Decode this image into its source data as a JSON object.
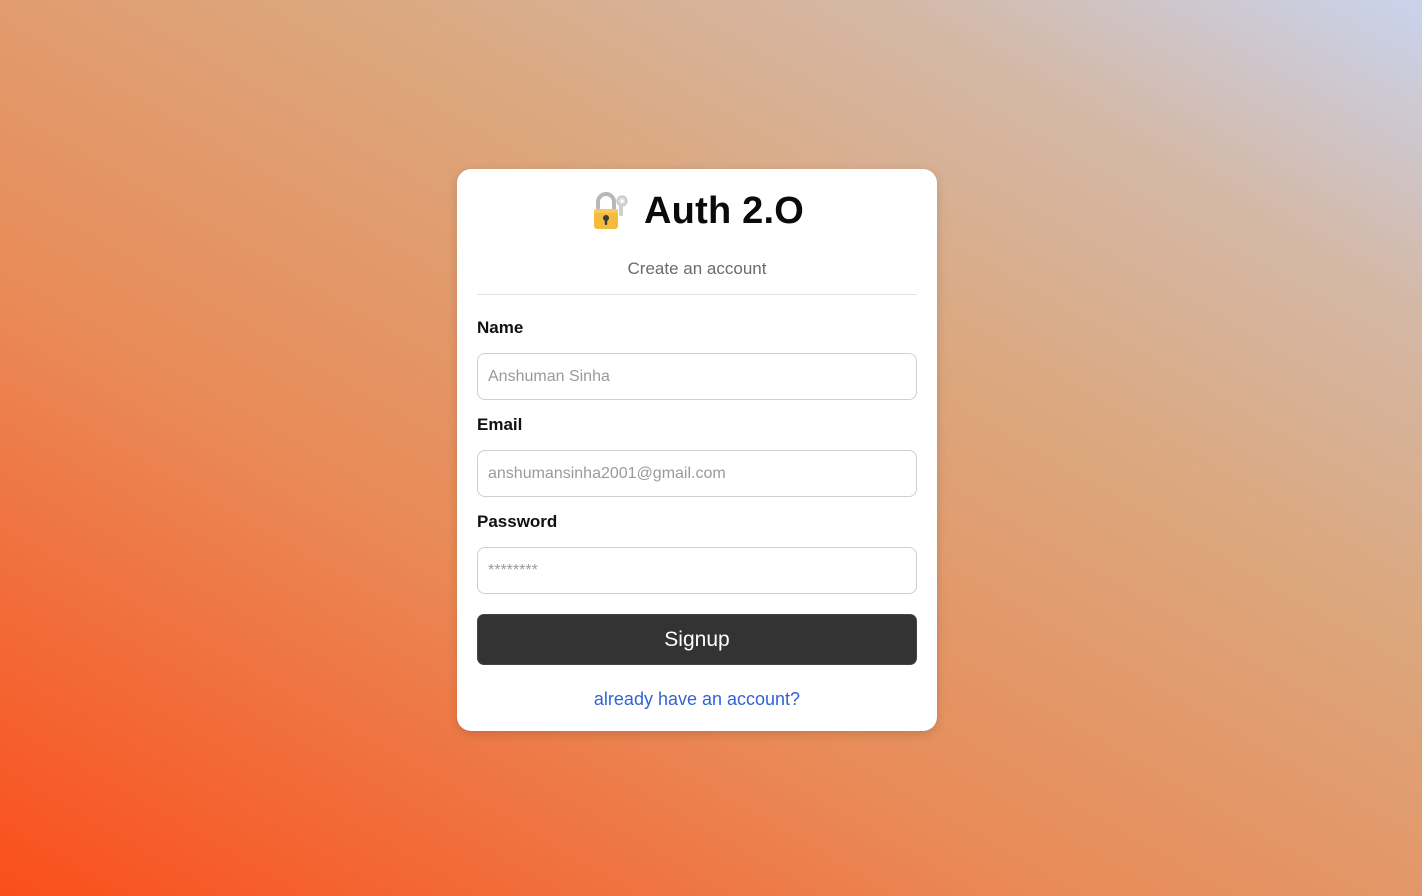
{
  "brand": {
    "icon": "lock-with-key-icon",
    "title": "Auth 2.O"
  },
  "form": {
    "subtitle": "Create an account",
    "name_label": "Name",
    "name_placeholder": "Anshuman Sinha",
    "email_label": "Email",
    "email_placeholder": "anshumansinha2001@gmail.com",
    "password_label": "Password",
    "password_placeholder": "********",
    "submit_label": "Signup",
    "login_link": "already have an account?"
  },
  "colors": {
    "button_bg": "#333333",
    "link": "#2f63d6",
    "gradient_start": "#fa4e1c",
    "gradient_end": "#c9d3ed"
  }
}
